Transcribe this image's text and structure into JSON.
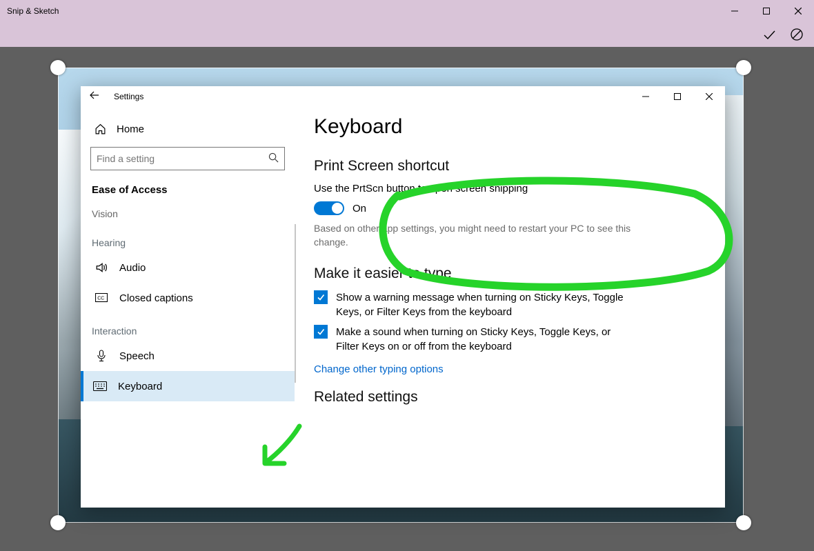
{
  "snip": {
    "title": "Snip & Sketch"
  },
  "settings": {
    "title": "Settings",
    "home": "Home",
    "search_placeholder": "Find a setting",
    "category": "Ease of Access",
    "groups": {
      "vision": "Vision",
      "hearing": "Hearing",
      "interaction": "Interaction"
    },
    "nav": {
      "audio": "Audio",
      "closed_captions": "Closed captions",
      "speech": "Speech",
      "keyboard": "Keyboard"
    }
  },
  "page": {
    "heading": "Keyboard",
    "section1": {
      "title": "Print Screen shortcut",
      "desc": "Use the PrtScn button to open screen snipping",
      "toggle_state": "On",
      "hint": "Based on other app settings, you might need to restart your PC to see this change."
    },
    "section2": {
      "title": "Make it easier to type",
      "chk1": "Show a warning message when turning on Sticky Keys, Toggle Keys, or Filter Keys from the keyboard",
      "chk2": "Make a sound when turning on Sticky Keys, Toggle Keys, or Filter Keys on or off from the keyboard",
      "link": "Change other typing options"
    },
    "section3": {
      "title": "Related settings"
    }
  }
}
